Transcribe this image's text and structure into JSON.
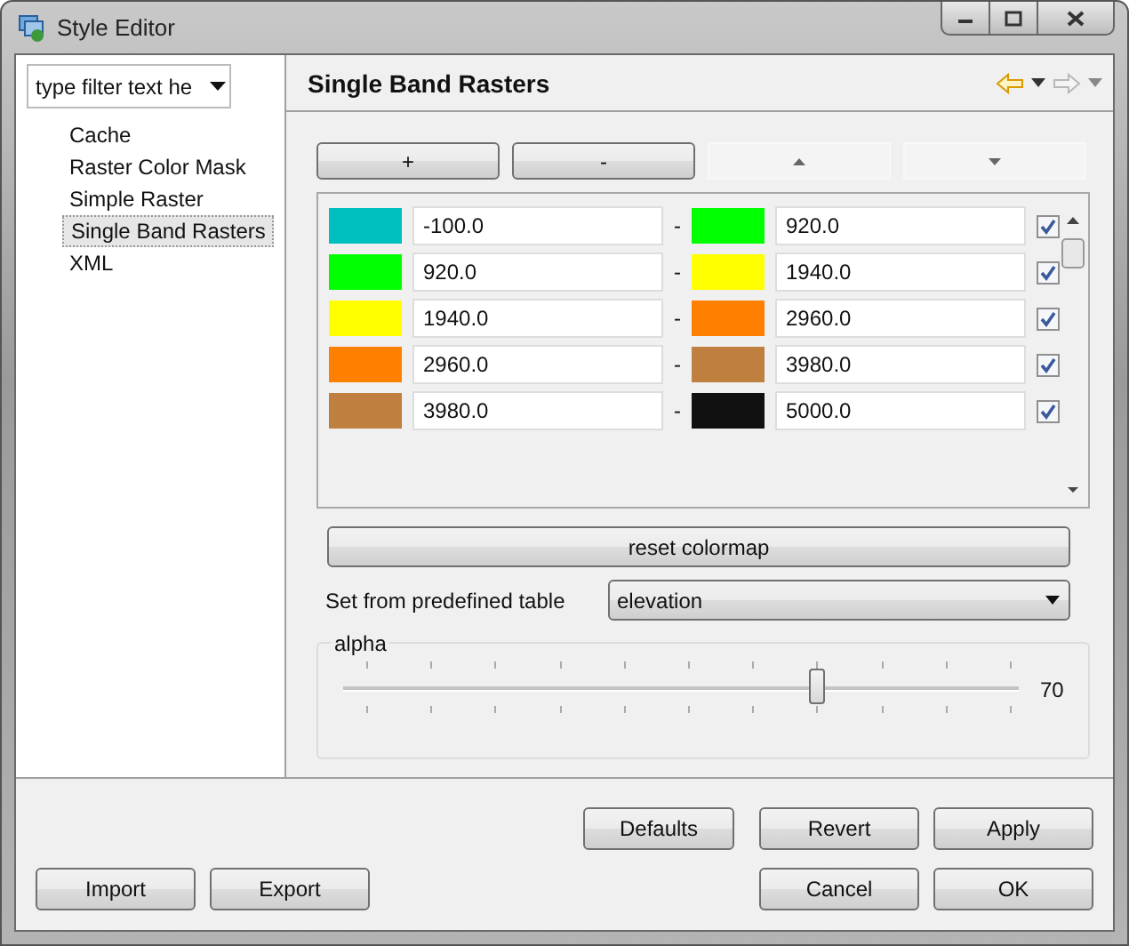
{
  "window": {
    "title": "Style Editor"
  },
  "sidebar": {
    "filter": {
      "placeholder": "type filter text he"
    },
    "items": [
      {
        "label": "Cache",
        "selected": false
      },
      {
        "label": "Raster Color Mask",
        "selected": false
      },
      {
        "label": "Simple Raster",
        "selected": false
      },
      {
        "label": "Single Band Rasters",
        "selected": true
      },
      {
        "label": "XML",
        "selected": false
      }
    ]
  },
  "page": {
    "title": "Single Band Rasters",
    "back_enabled": true,
    "forward_enabled": false
  },
  "toolbar": [
    {
      "kind": "text",
      "label": "+",
      "disabled": false
    },
    {
      "kind": "text",
      "label": "-",
      "disabled": false
    },
    {
      "kind": "up",
      "disabled": true
    },
    {
      "kind": "down",
      "disabled": true
    }
  ],
  "rows": [
    {
      "from": {
        "color": "#00bfbf",
        "value": "-100.0"
      },
      "separator": "-",
      "to": {
        "color": "#00ff00",
        "value": "920.0"
      },
      "checked": true
    },
    {
      "from": {
        "color": "#00ff00",
        "value": "920.0"
      },
      "separator": "-",
      "to": {
        "color": "#ffff00",
        "value": "1940.0"
      },
      "checked": true
    },
    {
      "from": {
        "color": "#ffff00",
        "value": "1940.0"
      },
      "separator": "-",
      "to": {
        "color": "#ff8000",
        "value": "2960.0"
      },
      "checked": true
    },
    {
      "from": {
        "color": "#ff8000",
        "value": "2960.0"
      },
      "separator": "-",
      "to": {
        "color": "#bf7f3f",
        "value": "3980.0"
      },
      "checked": true
    },
    {
      "from": {
        "color": "#bf7f3f",
        "value": "3980.0"
      },
      "separator": "-",
      "to": {
        "color": "#111111",
        "value": "5000.0"
      },
      "checked": true
    }
  ],
  "reset_button": "reset colormap",
  "predefined": {
    "label": "Set from predefined table",
    "value": "elevation"
  },
  "alpha": {
    "label": "alpha",
    "level": 0.7,
    "reading": "70"
  },
  "buttons_top": [
    "Defaults",
    "Revert",
    "Apply"
  ],
  "buttons_left": [
    "Import",
    "Export"
  ],
  "buttons_right": [
    "Cancel",
    "OK"
  ]
}
